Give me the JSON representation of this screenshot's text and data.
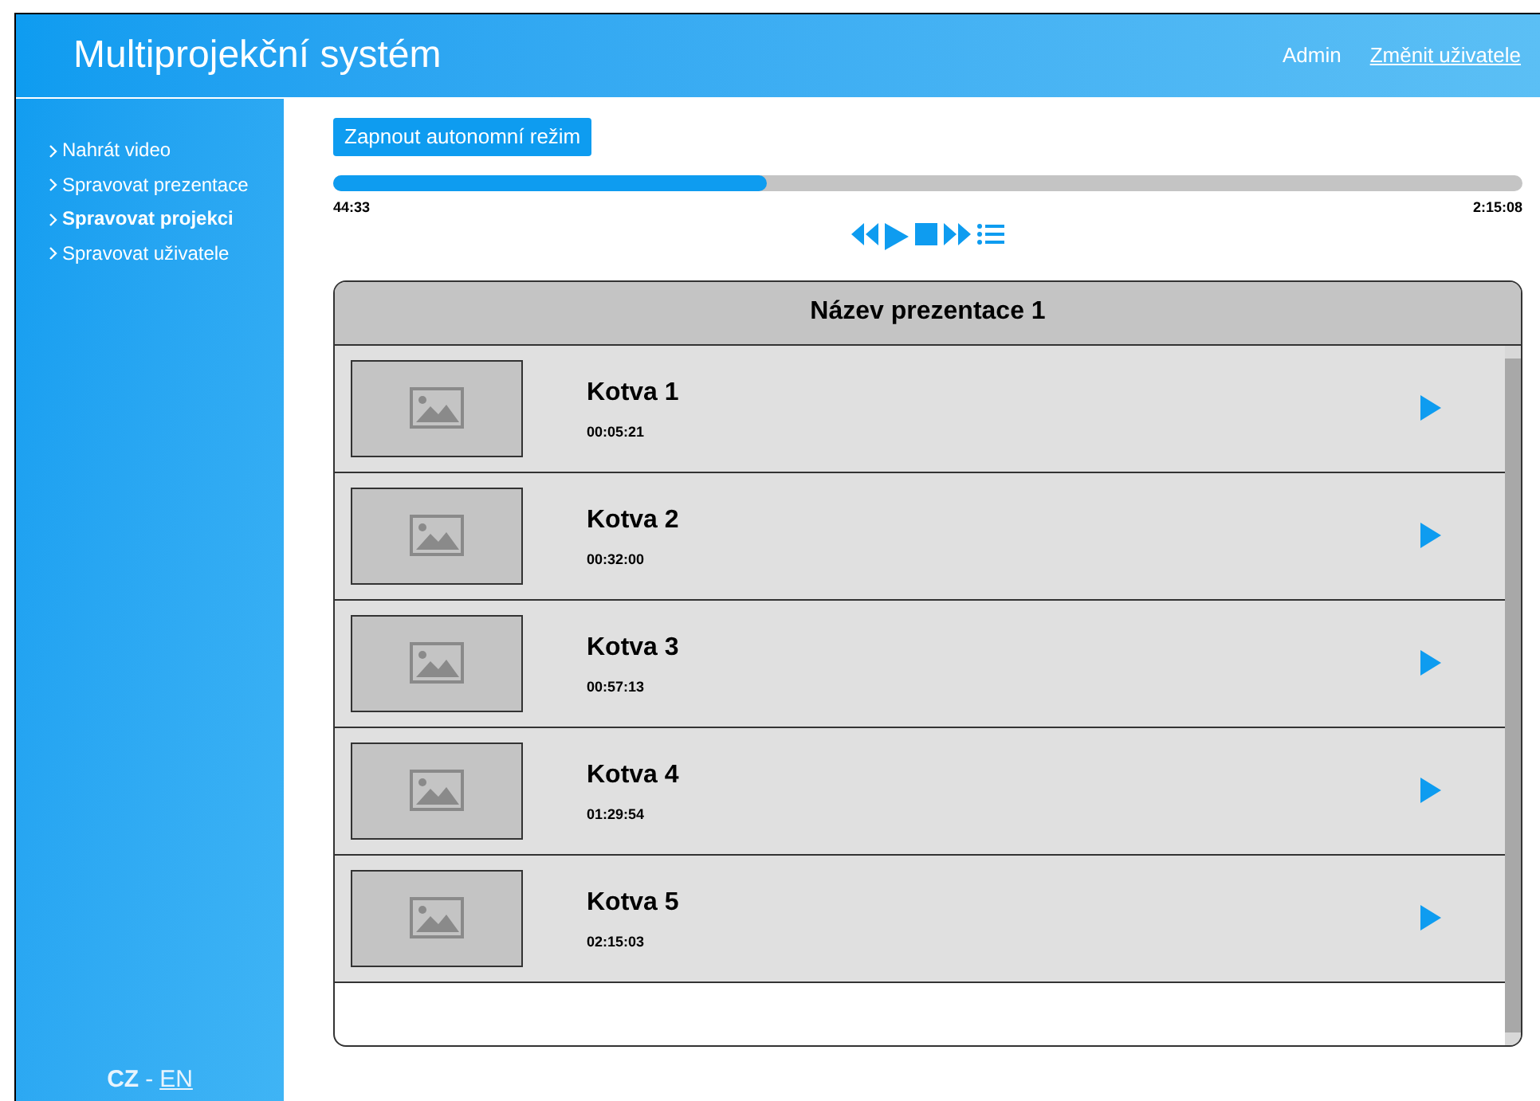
{
  "header": {
    "title": "Multiprojekční systém",
    "user": "Admin",
    "switch_user": "Změnit uživatele"
  },
  "sidebar": {
    "items": [
      {
        "label": "Nahrát video",
        "selected": false
      },
      {
        "label": "Spravovat prezentace",
        "selected": false
      },
      {
        "label": "Spravovat projekci",
        "selected": true
      },
      {
        "label": "Spravovat uživatele",
        "selected": false
      }
    ],
    "languages": [
      {
        "label": "CZ",
        "selected": true
      },
      {
        "label": "EN",
        "selected": false
      }
    ],
    "separator": "-"
  },
  "autonomous_button": "Zapnout autonomní režim",
  "player": {
    "level": 0.364,
    "elapsed": "44:33",
    "total": "2:15:08"
  },
  "presentation": {
    "title": "Název prezentace 1",
    "anchors": [
      {
        "name": "Kotva 1",
        "time": "00:05:21"
      },
      {
        "name": "Kotva 2",
        "time": "00:32:00"
      },
      {
        "name": "Kotva 3",
        "time": "00:57:13"
      },
      {
        "name": "Kotva 4",
        "time": "01:29:54"
      },
      {
        "name": "Kotva 5",
        "time": "02:15:03"
      }
    ]
  }
}
